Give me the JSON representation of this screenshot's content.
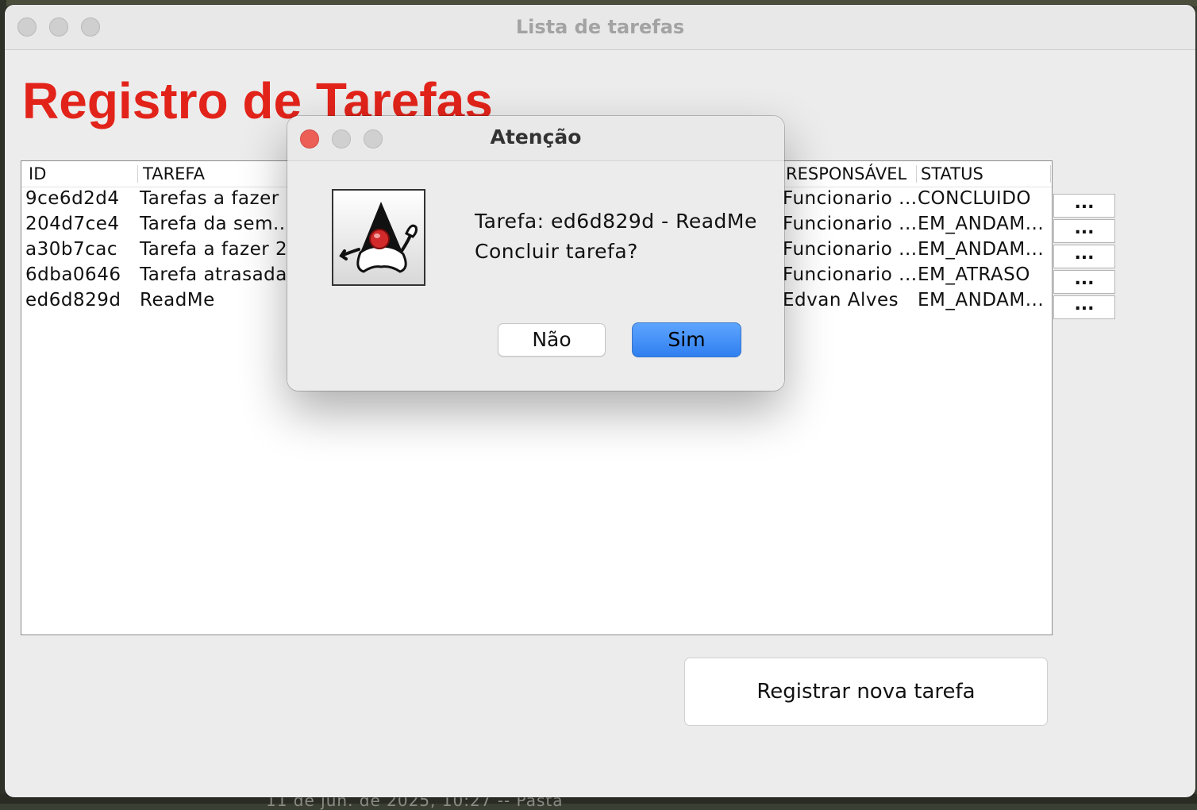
{
  "window": {
    "title": "Lista de tarefas"
  },
  "page_title": "Registro de Tarefas",
  "table": {
    "columns": [
      "ID",
      "TAREFA",
      "RESPONSÁVEL",
      "STATUS"
    ],
    "rows": [
      {
        "id": "9ce6d2d4",
        "tarefa": "Tarefas a fazer",
        "responsavel": "Funcionario ...",
        "status": "CONCLUIDO",
        "action": "..."
      },
      {
        "id": "204d7ce4",
        "tarefa": "Tarefa da sem...",
        "responsavel": "Funcionario ...",
        "status": "EM_ANDAM...",
        "action": "..."
      },
      {
        "id": "a30b7cac",
        "tarefa": "Tarefa a fazer 2",
        "responsavel": "Funcionario ...",
        "status": "EM_ANDAM...",
        "action": "..."
      },
      {
        "id": "6dba0646",
        "tarefa": "Tarefa atrasada",
        "responsavel": "Funcionario ...",
        "status": "EM_ATRASO",
        "action": "..."
      },
      {
        "id": "ed6d829d",
        "tarefa": "ReadMe",
        "responsavel": "Edvan Alves",
        "status": "EM_ANDAM...",
        "action": "..."
      }
    ]
  },
  "register_button": "Registrar nova tarefa",
  "dialog": {
    "title": "Atenção",
    "message_line1": "Tarefa: ed6d829d - ReadMe",
    "message_line2": "Concluir tarefa?",
    "no_label": "Não",
    "yes_label": "Sim"
  },
  "background": {
    "partial_text": "11 de jun. de 2025, 10:27   --   Pasta"
  },
  "colors": {
    "title_red": "#e2231a",
    "accent_blue": "#2f7ff0",
    "close_red": "#ec5f57"
  }
}
